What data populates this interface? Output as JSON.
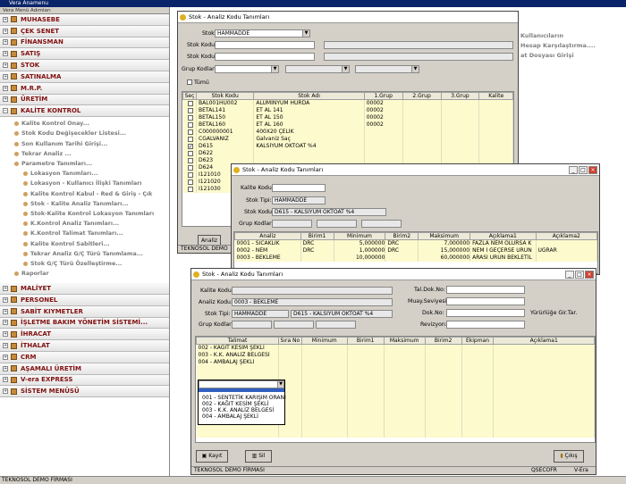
{
  "app": {
    "title": "Vera Anamenu",
    "status": "TEKNOSOL DEMO FİRMASI"
  },
  "sidebar": {
    "header": "Vera Menü Adımları",
    "items_top": [
      {
        "label": "MUHASEBE",
        "pm": "+"
      },
      {
        "label": "ÇEK SENET",
        "pm": "+"
      },
      {
        "label": "FİNANSMAN",
        "pm": "+"
      },
      {
        "label": "SATIŞ",
        "pm": "+"
      },
      {
        "label": "STOK",
        "pm": "+"
      },
      {
        "label": "SATINALMA",
        "pm": "+"
      },
      {
        "label": "M.R.P.",
        "pm": "+"
      },
      {
        "label": "ÜRETİM",
        "pm": "+"
      },
      {
        "label": "KALİTE KONTROL",
        "pm": "−"
      }
    ],
    "sub": [
      {
        "label": "Kalite Kontrol Onay...",
        "lvl": "l1"
      },
      {
        "label": "Stok Kodu Değişecekler Listesi...",
        "lvl": "l1"
      },
      {
        "label": "Son Kullanım Tarihi Girişi...",
        "lvl": "l1"
      },
      {
        "label": "Tekrar Analiz ...",
        "lvl": "l1"
      },
      {
        "label": "Parametre Tanımları...",
        "lvl": "l1"
      },
      {
        "label": "Lokasyon Tanımları...",
        "lvl": "l2"
      },
      {
        "label": "Lokasyon - Kullanıcı İlişki Tanımları",
        "lvl": "l2"
      },
      {
        "label": "Kalite Kontrol Kabul - Red & Giriş - Çık",
        "lvl": "l2"
      },
      {
        "label": "Stok - Kalite Analiz Tanımları...",
        "lvl": "l2"
      },
      {
        "label": "Stok-Kalite Kontrol Lokasyon Tanımları",
        "lvl": "l2"
      },
      {
        "label": "K.Kontrol Analiz Tanımları...",
        "lvl": "l2"
      },
      {
        "label": "K.Kontrol Talimat Tanımları...",
        "lvl": "l2"
      },
      {
        "label": "Kalite Kontrol Sabitleri...",
        "lvl": "l2"
      },
      {
        "label": "Tekrar Analiz G/Ç Türü Tanımlama...",
        "lvl": "l2"
      },
      {
        "label": "Stok G/Ç Türü Özelleştirme...",
        "lvl": "l2"
      },
      {
        "label": "Raporlar",
        "lvl": "l1"
      }
    ],
    "items_bottom": [
      {
        "label": "MALİYET",
        "pm": "+"
      },
      {
        "label": "PERSONEL",
        "pm": "+"
      },
      {
        "label": "SABİT KIYMETLER",
        "pm": "+"
      },
      {
        "label": "İŞLETME BAKIM YÖNETİM SİSTEMİ...",
        "pm": "+"
      },
      {
        "label": "İHRACAT",
        "pm": "+"
      },
      {
        "label": "İTHALAT",
        "pm": "+"
      },
      {
        "label": "CRM",
        "pm": "+"
      },
      {
        "label": "AŞAMALI ÜRETİM",
        "pm": "+"
      },
      {
        "label": "V-era EXPRESS",
        "pm": "+"
      },
      {
        "label": "SİSTEM MENÜSÜ",
        "pm": "+"
      }
    ]
  },
  "right_links": [
    "Kullanıcıların",
    "Hesap Karşılaştırma....",
    "at Dosyası Girişi"
  ],
  "w1": {
    "title": "Stok - Analiz Kodu Tanımları",
    "stok_tipi_label": "Stok Tipi:",
    "stok_tipi": "HAMMADDE",
    "stok_kodu_label": "Stok Kodu:",
    "grup_label": "Grup Kodları:",
    "tumu": "Tümü",
    "cols": [
      "Seç",
      "Stok Kodu",
      "Stok Adı",
      "1.Grup",
      "2.Grup",
      "3.Grup",
      "Kalite"
    ],
    "rows": [
      {
        "c": "",
        "k": "BAL001HU002",
        "a": "ALÜMİNYUM HURDA",
        "g": "00002"
      },
      {
        "c": "",
        "k": "BETAL141",
        "a": "ET AL 141",
        "g": "00002"
      },
      {
        "c": "",
        "k": "BETAL150",
        "a": "ET AL 150",
        "g": "00002"
      },
      {
        "c": "",
        "k": "BETAL160",
        "a": "ET AL 160",
        "g": "00002"
      },
      {
        "c": "",
        "k": "C000000001",
        "a": "400X20 ÇELİK",
        "g": ""
      },
      {
        "c": "",
        "k": "CGALVANIZ",
        "a": "Galvaniz Saç",
        "g": ""
      },
      {
        "c": "✓",
        "k": "D615",
        "a": "KALSİYUM OKTOAT %4",
        "g": ""
      },
      {
        "c": "",
        "k": "D622",
        "a": "",
        "g": ""
      },
      {
        "c": "",
        "k": "D623",
        "a": "",
        "g": ""
      },
      {
        "c": "",
        "k": "D624",
        "a": "",
        "g": ""
      },
      {
        "c": "",
        "k": "I121010",
        "a": "",
        "g": ""
      },
      {
        "c": "",
        "k": "I121020",
        "a": "",
        "g": ""
      },
      {
        "c": "",
        "k": "I121030",
        "a": "",
        "g": ""
      }
    ],
    "btn": "Analiz",
    "status": "TEKNOSOL DEMO"
  },
  "w2": {
    "title": "Stok - Analiz Kodu Tanımları",
    "kalite_label": "Kalite Kodu:",
    "stok_tipi_label": "Stok Tipi:",
    "stok_tipi": "HAMMADDE",
    "stok_kodu_label": "Stok Kodu:",
    "stok_kodu": "D615 - KALSİYUM OKTOAT %4",
    "grup_label": "Grup Kodları:",
    "cols": [
      "Analiz",
      "Birim1",
      "Minimum",
      "Birim2",
      "Maksimum",
      "Açıklama1",
      "Açıklama2"
    ],
    "rows": [
      [
        "0001 - SICAKLIK",
        "DRC",
        "5,000000",
        "DRC",
        "7,000000",
        "FAZLA NEM OLURSA K",
        ""
      ],
      [
        "0002 - NEM",
        "DRC",
        "1,000000",
        "DRC",
        "15,000000",
        "NEM İ GEÇERSE ÜRÜN",
        "UGRAR"
      ],
      [
        "0003 - BEKLEME",
        "",
        "10,000000",
        "",
        "60,000000",
        "ARASI ÜRÜN BEKLETİL",
        ""
      ]
    ]
  },
  "w3": {
    "title": "Stok - Analiz Kodu Tanımları",
    "kalite_label": "Kalite Kodu:",
    "analiz_label": "Analiz Kodu:",
    "analiz": "0003 - BEKLEME",
    "stok_tipi_label": "Stok Tipi:",
    "stok_tipi": "HAMMADDE",
    "stok_kodu": "D615 - KALSİYUM OKTOAT %4",
    "grup_label": "Grup Kodları:",
    "tal_label": "Tal.Dok.No:",
    "muay_label": "Muay.Seviyesi:",
    "dok_label": "Dok.No:",
    "yuk_label": "Yürürlüğe Gir.Tar.",
    "rev_label": "Revizyon:",
    "cols": [
      "Talimat",
      "Sıra No",
      "Minimum",
      "Birim1",
      "Maksimum",
      "Birim2",
      "Ekipman",
      "Açıklama1"
    ],
    "rows": [
      "002 - KAĞIT KESİM ŞEKLİ",
      "003 - K.K. ANALİZ BELGESİ",
      "004 - AMBALAJ ŞEKLİ"
    ],
    "popup": [
      "001 - SENTETİK KARIŞIM ORANI",
      "002 - KAĞIT KESİM ŞEKLİ",
      "003 - K.K. ANALİZ BELGESİ",
      "004 - AMBALAJ ŞEKLİ"
    ],
    "kayit": "Kayıt",
    "sil": "Sil",
    "cikis": "Çıkış",
    "status_left": "TEKNOSOL DEMO FİRMASI",
    "status_mid": "QSECOFR",
    "status_right": "V-Era"
  }
}
